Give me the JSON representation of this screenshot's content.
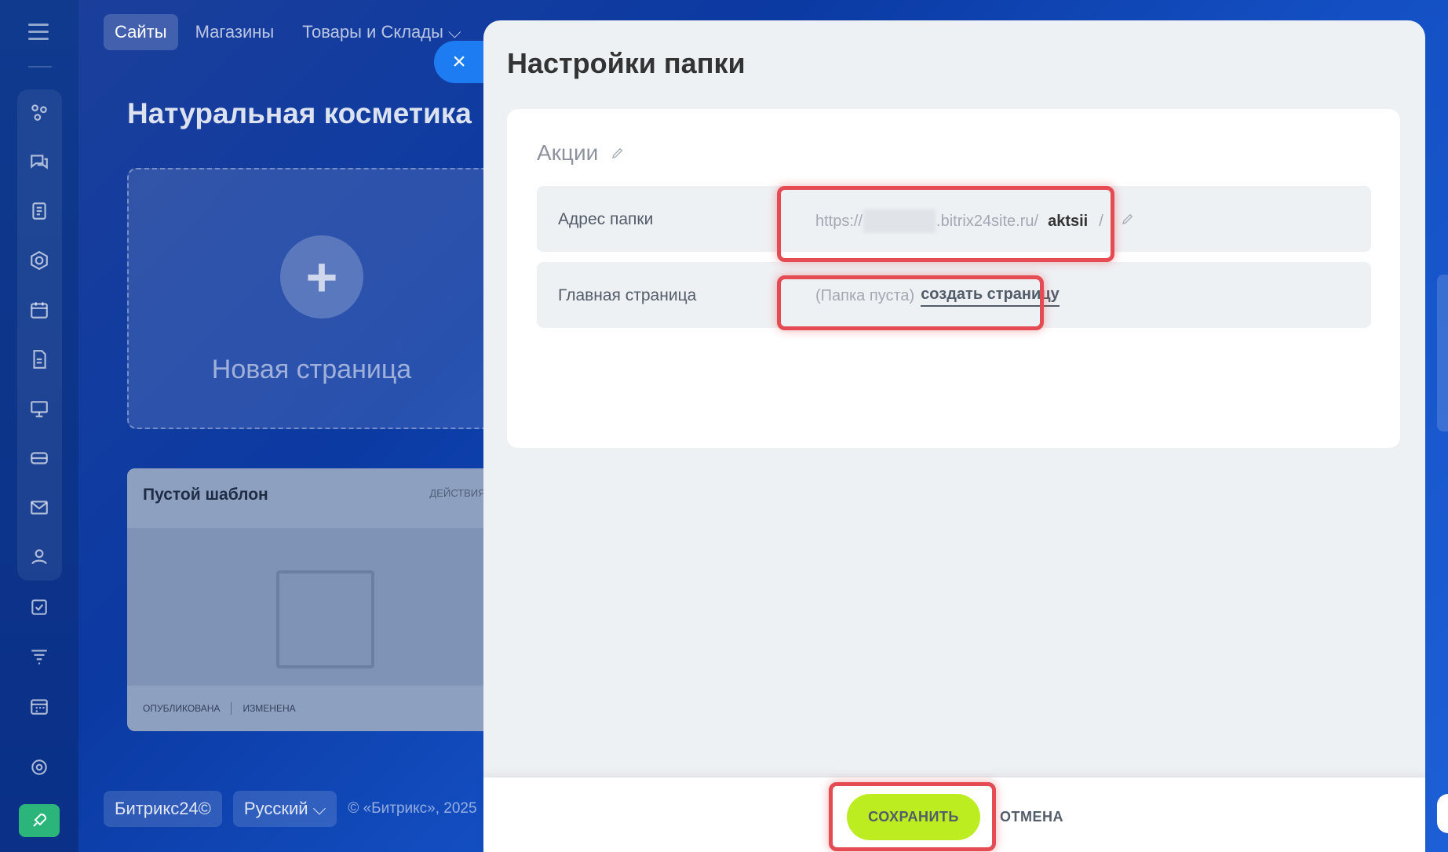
{
  "topnav": {
    "tabs": [
      {
        "label": "Сайты"
      },
      {
        "label": "Магазины"
      },
      {
        "label": "Товары и Склады ⌵"
      }
    ]
  },
  "page": {
    "title": "Натуральная косметика",
    "new_page_label": "Новая страница",
    "template_card": {
      "title": "Пустой шаблон",
      "actions_label": "ДЕЙСТВИЯ ⌵",
      "status_published": "ОПУБЛИКОВАНА",
      "status_changed": "ИЗМЕНЕНА"
    }
  },
  "footer": {
    "brand_label": "Битрикс24©",
    "language_label": "Русский ⌵",
    "copyright": "© «Битрикс», 2025"
  },
  "slider": {
    "close_icon": "×",
    "title": "Настройки папки",
    "folder_name": "Акции",
    "address": {
      "label": "Адрес папки",
      "url_prefix": "https://",
      "url_host": ".bitrix24site.ru/",
      "slug": "aktsii",
      "slash": "/"
    },
    "main_page": {
      "label": "Главная страница",
      "empty_note": "(Папка пуста)",
      "create_link": "создать страницу"
    },
    "buttons": {
      "save": "СОХРАНИТЬ",
      "cancel": "ОТМЕНА"
    }
  },
  "colors": {
    "save_button": "#bbed21",
    "highlight": "#e54b52",
    "close_button": "#1e7cf2"
  }
}
